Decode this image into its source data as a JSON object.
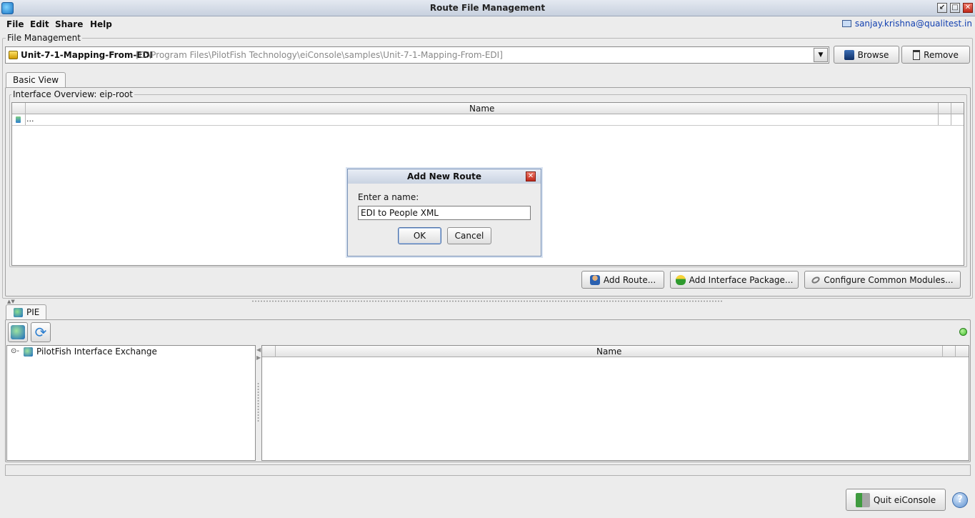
{
  "window": {
    "title": "Route File Management",
    "controls": {
      "minimize": "↙",
      "maximize": "□",
      "close": "✕"
    }
  },
  "menu": {
    "items": [
      "File",
      "Edit",
      "Share",
      "Help"
    ],
    "user": "sanjay.krishna@qualitest.in"
  },
  "file_management": {
    "legend": "File Management",
    "selected_file": "Unit-7-1-Mapping-From-EDI",
    "selected_path": "[C:\\Program Files\\PilotFish Technology\\eiConsole\\samples\\Unit-7-1-Mapping-From-EDI]",
    "browse_label": "Browse",
    "remove_label": "Remove"
  },
  "basic_view": {
    "tab_label": "Basic View",
    "overview_legend": "Interface Overview: eip-root",
    "table_header": "Name",
    "rows": [
      "..."
    ],
    "add_route_label": "Add Route...",
    "add_package_label": "Add Interface Package...",
    "configure_label": "Configure Common Modules..."
  },
  "dialog": {
    "title": "Add New Route",
    "prompt": "Enter a name:",
    "value": "EDI to People XML",
    "ok_label": "OK",
    "cancel_label": "Cancel"
  },
  "pie": {
    "tab_label": "PIE",
    "tree_root": "PilotFish Interface Exchange",
    "table_header": "Name",
    "status_color": "#3fbf2a"
  },
  "footer": {
    "quit_label": "Quit eiConsole",
    "help_glyph": "?"
  }
}
